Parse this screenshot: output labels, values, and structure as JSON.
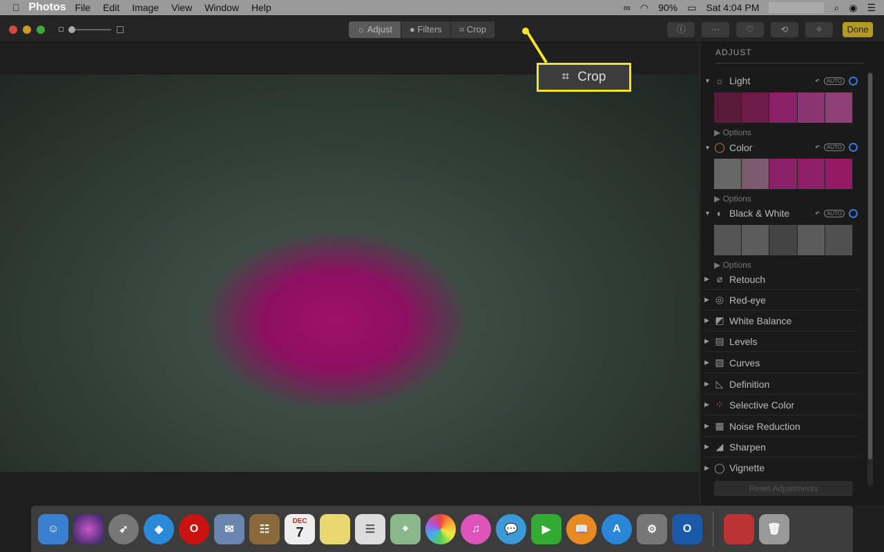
{
  "menubar": {
    "apple": "",
    "items": [
      "Photos",
      "File",
      "Edit",
      "Image",
      "View",
      "Window",
      "Help"
    ],
    "battery": "90%",
    "clock": "Sat 4:04 PM"
  },
  "toolbar": {
    "tabs": [
      "Adjust",
      "Filters",
      "Crop"
    ],
    "active_tab": "Adjust",
    "done": "Done",
    "icons": [
      "info-icon",
      "more-icon",
      "heart-icon",
      "rotate-icon",
      "magic-wand-icon"
    ]
  },
  "callout": {
    "label": "Crop",
    "color": "#f2e52a"
  },
  "sidebar": {
    "title": "ADJUST",
    "sections": [
      {
        "label": "Light",
        "auto": "AUTO",
        "options": "Options"
      },
      {
        "label": "Color",
        "auto": "AUTO",
        "options": "Options"
      },
      {
        "label": "Black & White",
        "auto": "AUTO",
        "options": "Options"
      }
    ],
    "items": [
      "Retouch",
      "Red-eye",
      "White Balance",
      "Levels",
      "Curves",
      "Definition",
      "Selective Color",
      "Noise Reduction",
      "Sharpen",
      "Vignette"
    ],
    "reset": "Reset Adjustments"
  },
  "dock": {
    "calendar_month": "DEC",
    "calendar_day": "7",
    "apps": [
      "Finder",
      "Siri",
      "Launchpad",
      "Safari",
      "Opera",
      "Mail",
      "Contacts",
      "Calendar",
      "Notes",
      "Reminders",
      "Maps",
      "Photos",
      "iTunes",
      "Messages",
      "FaceTime",
      "Books",
      "App Store",
      "System Preferences",
      "Outlook",
      "Preview",
      "Trash"
    ]
  }
}
